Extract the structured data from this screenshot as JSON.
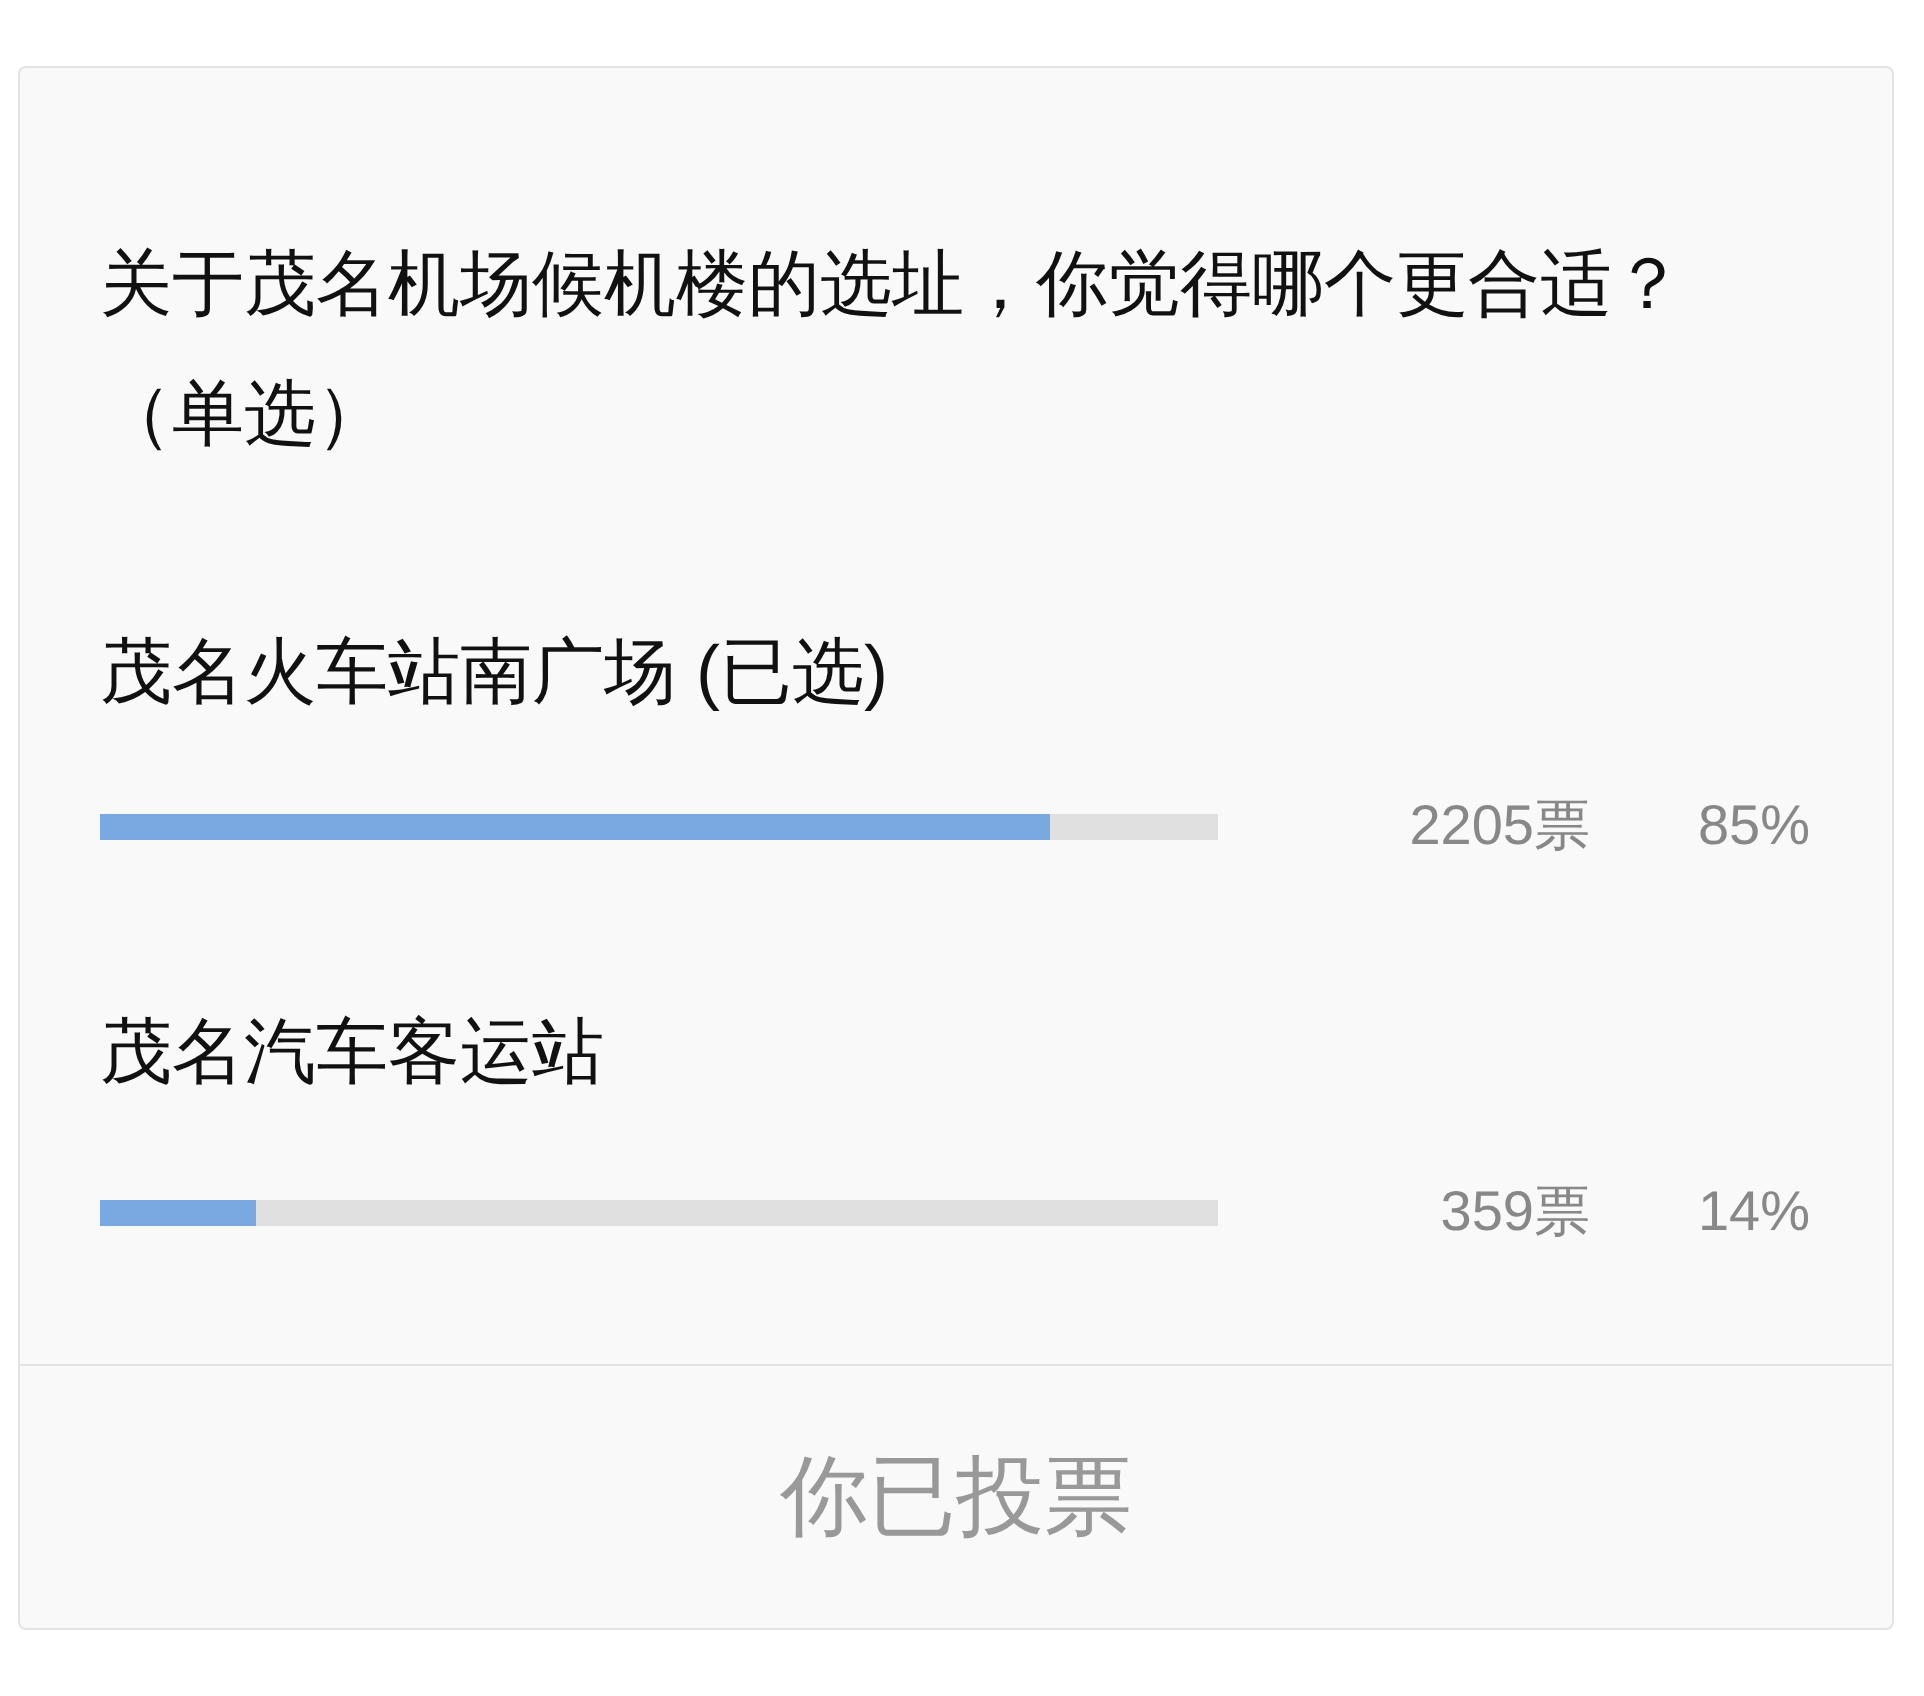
{
  "poll": {
    "question": "关于茂名机场候机楼的选址，你觉得哪个更合适？（单选）",
    "options": [
      {
        "label": "茂名火车站南广场",
        "tag": "(已选)",
        "level": 0.85,
        "votes": "2205票",
        "percent": "85%"
      },
      {
        "label": "茂名汽车客运站",
        "level": 0.14,
        "votes": "359票",
        "percent": "14%"
      }
    ],
    "status": "你已投票"
  }
}
